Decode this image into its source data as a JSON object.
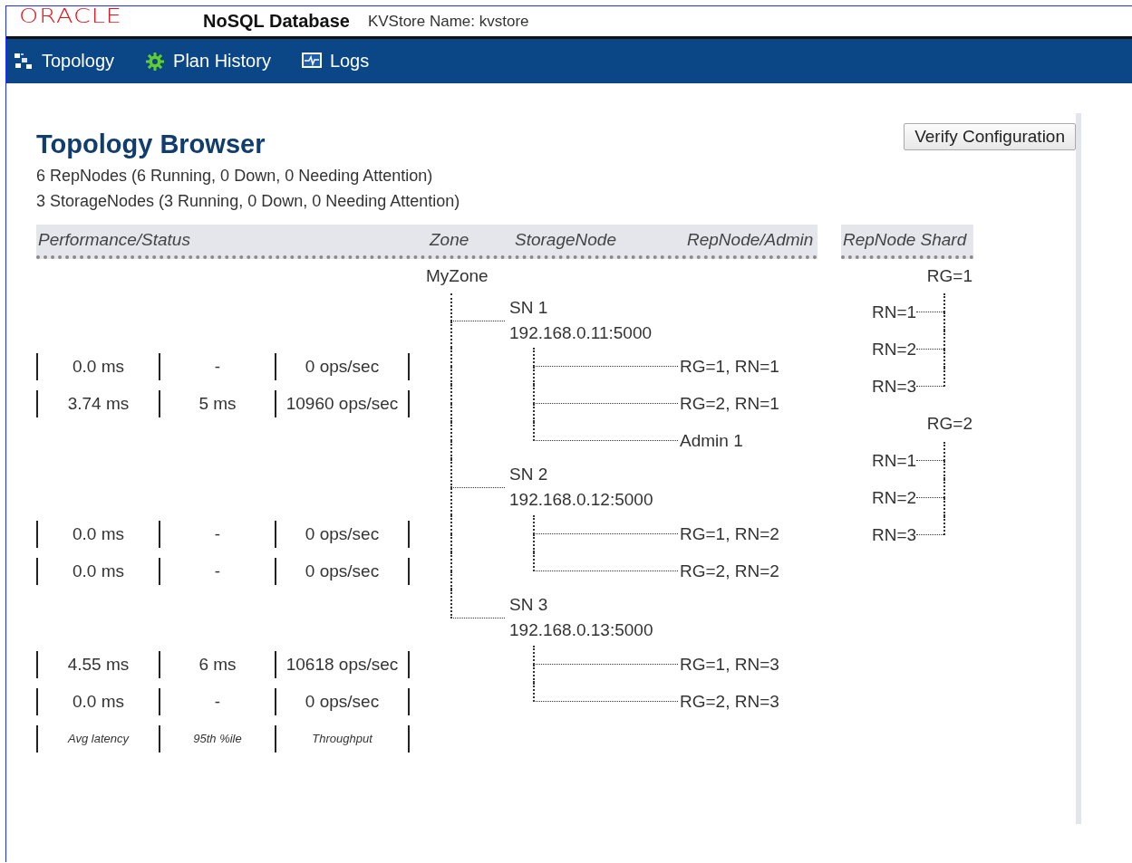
{
  "header": {
    "logo": "ORACLE",
    "product": "NoSQL Database",
    "store_name": "KVStore Name: kvstore"
  },
  "nav": [
    {
      "label": "Topology"
    },
    {
      "label": "Plan History"
    },
    {
      "label": "Logs"
    }
  ],
  "page": {
    "title": "Topology Browser",
    "summary": [
      "6 RepNodes (6 Running, 0 Down, 0 Needing Attention)",
      "3 StorageNodes (3 Running, 0 Down, 0 Needing Attention)"
    ],
    "verify_button": "Verify Configuration"
  },
  "topology": {
    "columns": [
      "Performance/Status",
      "Zone",
      "StorageNode",
      "RepNode/Admin"
    ],
    "zone": "MyZone",
    "storage_nodes": [
      {
        "name": "SN 1",
        "address": "192.168.0.11:5000",
        "children": [
          {
            "kind": "repnode",
            "label": "RG=1, RN=1",
            "avg_latency": "0.0 ms",
            "p95": "-",
            "throughput": "0 ops/sec"
          },
          {
            "kind": "repnode",
            "label": "RG=2, RN=1",
            "avg_latency": "3.74 ms",
            "p95": "5 ms",
            "throughput": "10960 ops/sec"
          },
          {
            "kind": "admin",
            "label": "Admin 1"
          }
        ]
      },
      {
        "name": "SN 2",
        "address": "192.168.0.12:5000",
        "children": [
          {
            "kind": "repnode",
            "label": "RG=1, RN=2",
            "avg_latency": "0.0 ms",
            "p95": "-",
            "throughput": "0 ops/sec"
          },
          {
            "kind": "repnode",
            "label": "RG=2, RN=2",
            "avg_latency": "0.0 ms",
            "p95": "-",
            "throughput": "0 ops/sec"
          }
        ]
      },
      {
        "name": "SN 3",
        "address": "192.168.0.13:5000",
        "children": [
          {
            "kind": "repnode",
            "label": "RG=1, RN=3",
            "avg_latency": "4.55 ms",
            "p95": "6 ms",
            "throughput": "10618 ops/sec"
          },
          {
            "kind": "repnode",
            "label": "RG=2, RN=3",
            "avg_latency": "0.0 ms",
            "p95": "-",
            "throughput": "0 ops/sec"
          }
        ]
      }
    ],
    "metric_labels": [
      "Avg latency",
      "95th %ile",
      "Throughput"
    ]
  },
  "shards": {
    "column": "RepNode Shard",
    "groups": [
      {
        "name": "RG=1",
        "nodes": [
          "RN=1",
          "RN=2",
          "RN=3"
        ]
      },
      {
        "name": "RG=2",
        "nodes": [
          "RN=1",
          "RN=2",
          "RN=3"
        ]
      }
    ]
  }
}
